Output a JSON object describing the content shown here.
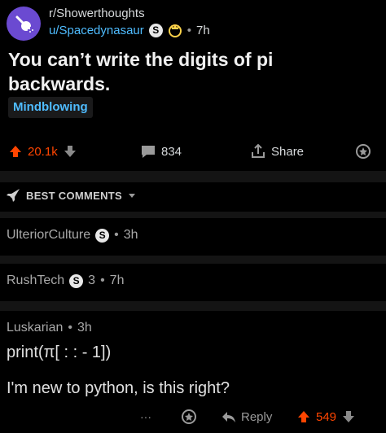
{
  "post": {
    "subreddit": "r/Showerthoughts",
    "username": "u/Spacedynasaur",
    "user_badge": "S",
    "time": "7h",
    "title": "You can’t write the digits of pi backwards.",
    "flair": "Mindblowing"
  },
  "actions": {
    "upvotes": "20.1k",
    "comments": "834",
    "share": "Share"
  },
  "sort": {
    "label": "BEST COMMENTS"
  },
  "comments": [
    {
      "author": "UlteriorCulture",
      "badge": "S",
      "time": "3h"
    },
    {
      "author": "RushTech",
      "badge": "S",
      "score": "3",
      "time": "7h"
    },
    {
      "author": "Luskarian",
      "time": "3h",
      "line1": "print(π[ : : - 1])",
      "line2": "I'm new to python, is this right?",
      "reply": "Reply",
      "score": "549",
      "more": "···"
    }
  ],
  "colors": {
    "upvote": "#ff4500",
    "link": "#4fbcff",
    "background": "#000000"
  }
}
